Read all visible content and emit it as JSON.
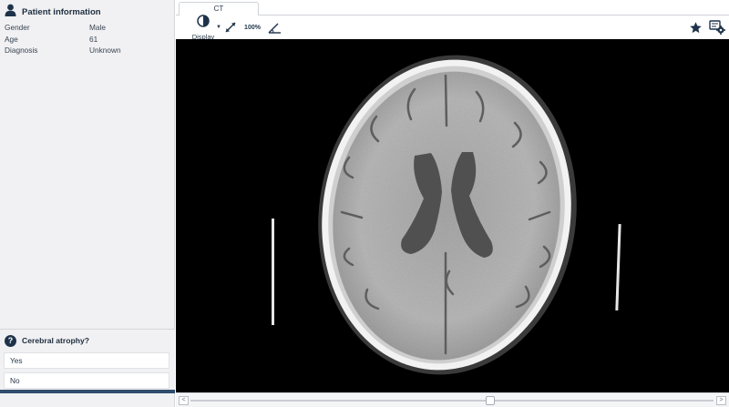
{
  "sidebar": {
    "header": {
      "title": "Patient information",
      "icon": "person-icon"
    },
    "info": [
      {
        "label": "Gender",
        "value": "Male"
      },
      {
        "label": "Age",
        "value": "61"
      },
      {
        "label": "Diagnosis",
        "value": "Unknown"
      }
    ],
    "question": {
      "icon": "question-icon",
      "text": "Cerebral atrophy?",
      "answers": [
        "Yes",
        "No"
      ]
    }
  },
  "main": {
    "tab_label": "CT",
    "toolbar": {
      "display_label": "Display",
      "zoom_label": "100%",
      "icons": [
        "contrast-icon",
        "caret-down-icon",
        "fit-icon",
        "zoom-100-icon",
        "angle-icon",
        "star-icon",
        "settings-icon"
      ]
    },
    "scrollbar": {
      "left_arrow": "<",
      "right_arrow": ">"
    }
  },
  "colors": {
    "accent": "#1e3349",
    "sidebar_bg": "#f1f1f3",
    "viewport_bg": "#000000"
  }
}
